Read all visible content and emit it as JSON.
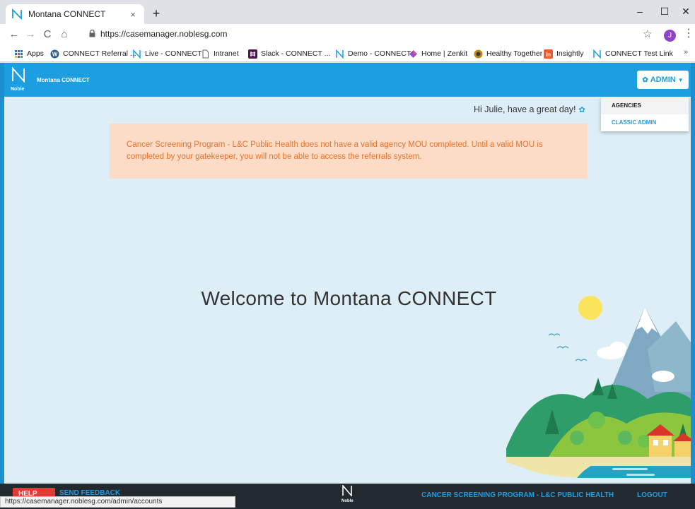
{
  "browser": {
    "tab_title": "Montana CONNECT",
    "tab_close": "×",
    "new_tab": "+",
    "window_controls": {
      "minimize": "–",
      "maximize": "☐",
      "close": "✕"
    },
    "url": "https://casemanager.noblesg.com",
    "profile_initial": "J",
    "bookmarks": [
      {
        "label": "Apps",
        "icon": "apps-grid-icon"
      },
      {
        "label": "CONNECT Referral ...",
        "icon": "wordpress-icon"
      },
      {
        "label": "Live - CONNECT",
        "icon": "noble-logo-icon"
      },
      {
        "label": "Intranet",
        "icon": "page-icon"
      },
      {
        "label": "Slack - CONNECT ...",
        "icon": "slack-icon"
      },
      {
        "label": "Demo - CONNECT",
        "icon": "noble-logo-icon"
      },
      {
        "label": "Home | Zenkit",
        "icon": "zenkit-icon"
      },
      {
        "label": "Healthy Together",
        "icon": "healthy-together-icon"
      },
      {
        "label": "Insightly",
        "icon": "insightly-icon"
      },
      {
        "label": "CONNECT Test Link",
        "icon": "noble-logo-icon"
      }
    ],
    "bookmarks_more": "»",
    "status_url": "https://casemanager.noblesg.com/admin/accounts"
  },
  "app": {
    "brand_name": "Montana CONNECT",
    "brand_sub": "Noble",
    "admin_button": "ADMIN",
    "admin_menu": [
      "AGENCIES",
      "CLASSIC ADMIN"
    ],
    "greeting": "Hi Julie, have a great day!",
    "alert_text": "Cancer Screening Program - L&C Public Health does not have a valid agency MOU completed. Until a valid MOU is completed by your gatekeeper, you will not be able to access the referrals system.",
    "welcome": "Welcome to Montana CONNECT",
    "footer": {
      "help": "HELP",
      "feedback": "SEND FEEDBACK",
      "noble": "Noble",
      "agency": "CANCER SCREENING PROGRAM - L&C PUBLIC HEALTH",
      "logout": "LOGOUT"
    }
  },
  "colors": {
    "brand_blue": "#1d9ee0",
    "page_bg": "#ddeef6",
    "alert_bg": "#fcdcc6",
    "alert_text": "#e8742b",
    "footer_bg": "#222a30"
  }
}
